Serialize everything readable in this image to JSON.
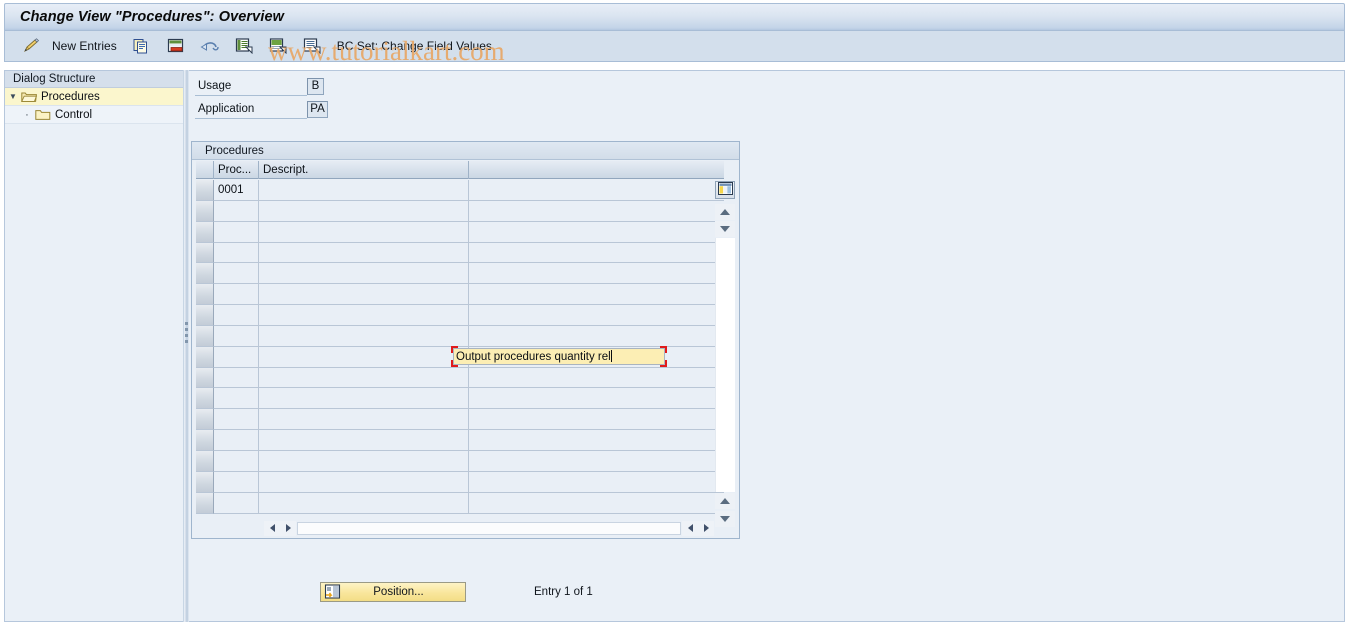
{
  "window": {
    "title": "Change View \"Procedures\": Overview"
  },
  "toolbar": {
    "edit_icon": "pencil-icon",
    "new_entries_label": "New Entries",
    "copy_icon": "copy-icon",
    "delete_icon": "delete-row-icon",
    "undo_icon": "undo-icon",
    "select_all_icon": "select-all-icon",
    "deselect_all_icon": "deselect-all-icon",
    "details_icon": "details-icon",
    "bc_set_label": "BC Set: Change Field Values"
  },
  "watermark": {
    "text": "www.tutorialkart.com"
  },
  "sidebar": {
    "header": "Dialog Structure",
    "items": [
      {
        "label": "Procedures",
        "icon": "open-folder-icon",
        "selected": true,
        "level": 0,
        "expander": "▼"
      },
      {
        "label": "Control",
        "icon": "folder-icon",
        "selected": false,
        "level": 1,
        "expander": "·"
      }
    ]
  },
  "key_fields": [
    {
      "label": "Usage",
      "value": "B"
    },
    {
      "label": "Application",
      "value": "PA"
    }
  ],
  "table": {
    "title": "Procedures",
    "config_icon": "table-settings-icon",
    "columns": [
      {
        "key": "sel",
        "label": ""
      },
      {
        "key": "proc",
        "label": "Proc..."
      },
      {
        "key": "descr",
        "label": "Descript."
      },
      {
        "key": "rest",
        "label": ""
      }
    ],
    "rows": [
      {
        "proc": "0001",
        "descr": "Output procedures quantity rel",
        "editing": true
      },
      {
        "proc": "",
        "descr": "",
        "editing": false
      },
      {
        "proc": "",
        "descr": "",
        "editing": false
      },
      {
        "proc": "",
        "descr": "",
        "editing": false
      },
      {
        "proc": "",
        "descr": "",
        "editing": false
      },
      {
        "proc": "",
        "descr": "",
        "editing": false
      },
      {
        "proc": "",
        "descr": "",
        "editing": false
      },
      {
        "proc": "",
        "descr": "",
        "editing": false
      },
      {
        "proc": "",
        "descr": "",
        "editing": false
      },
      {
        "proc": "",
        "descr": "",
        "editing": false
      },
      {
        "proc": "",
        "descr": "",
        "editing": false
      },
      {
        "proc": "",
        "descr": "",
        "editing": false
      },
      {
        "proc": "",
        "descr": "",
        "editing": false
      },
      {
        "proc": "",
        "descr": "",
        "editing": false
      },
      {
        "proc": "",
        "descr": "",
        "editing": false
      },
      {
        "proc": "",
        "descr": "",
        "editing": false
      }
    ],
    "edit_value": "Output procedures quantity rel"
  },
  "footer": {
    "position_label": "Position...",
    "position_icon": "position-icon",
    "entry_text": "Entry 1 of 1"
  },
  "colors": {
    "title_gradient_top": "#e8eef7",
    "title_gradient_bottom": "#b3c7e0",
    "toolbar_bg": "#d3dfec",
    "panel_bg": "#eaf0f7",
    "selected_row": "#fbf6cd",
    "edit_field": "#fceeb4",
    "focus_border": "#e01b1b",
    "watermark": "#e8a96a",
    "button_yellow": "#f9e69c"
  }
}
